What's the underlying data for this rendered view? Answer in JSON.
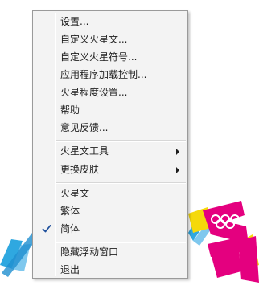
{
  "menu": {
    "items": [
      {
        "label": "设置..."
      },
      {
        "label": "自定义火星文..."
      },
      {
        "label": "自定义火星符号..."
      },
      {
        "label": "应用程序加载控制..."
      },
      {
        "label": "火星程度设置..."
      },
      {
        "label": "帮助"
      },
      {
        "label": "意见反馈..."
      },
      {
        "label": "火星文工具",
        "submenu": true
      },
      {
        "label": "更换皮肤",
        "submenu": true
      },
      {
        "label": "火星文"
      },
      {
        "label": "繁体"
      },
      {
        "label": "简体",
        "checked": true
      },
      {
        "label": "隐藏浮动窗口"
      },
      {
        "label": "退出"
      }
    ]
  },
  "backdrop": {
    "logo_name": "london-2012-olympic-logo",
    "colors": {
      "magenta": "#e4007f",
      "yellow": "#f5d90a",
      "blue": "#2fa8e0"
    }
  },
  "icons": {
    "check": "check-icon",
    "submenu": "arrow-right-icon"
  }
}
